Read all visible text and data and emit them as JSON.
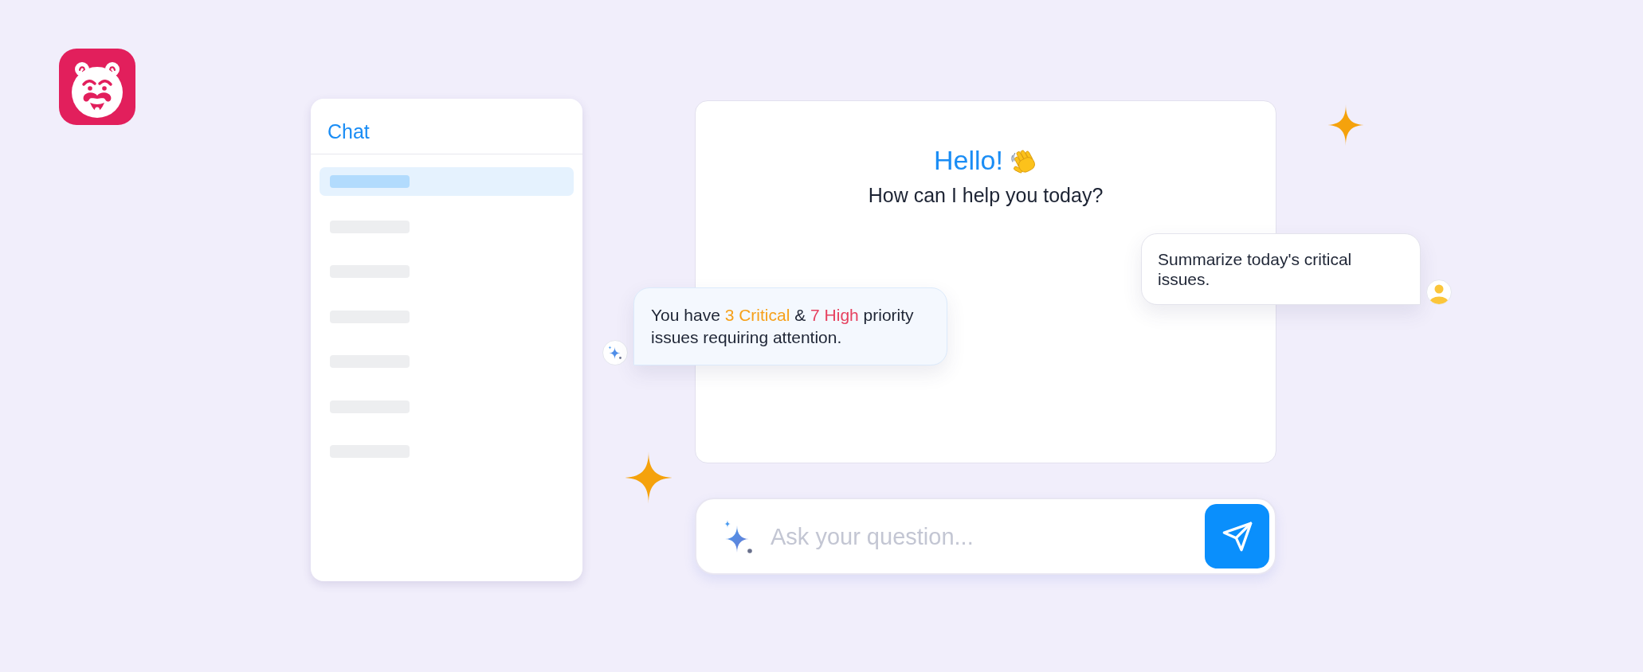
{
  "sidebar": {
    "title": "Chat",
    "items": [
      {
        "selected": true
      },
      {
        "selected": false
      },
      {
        "selected": false
      },
      {
        "selected": false
      },
      {
        "selected": false
      },
      {
        "selected": false
      },
      {
        "selected": false
      }
    ]
  },
  "greeting": {
    "title": "Hello!",
    "subtitle": "How can I help you today?"
  },
  "messages": [
    {
      "kind": "user",
      "segments": [
        {
          "text": "Summarize today's critical issues."
        }
      ]
    },
    {
      "kind": "assistant",
      "segments": [
        {
          "text": "You have "
        },
        {
          "text": "3 Critical",
          "color": "#f6a01a"
        },
        {
          "text": " & "
        },
        {
          "text": "7 High",
          "color": "#e6415f"
        },
        {
          "text": " priority issues requiring attention."
        }
      ]
    }
  ],
  "input": {
    "placeholder": "Ask your question..."
  }
}
